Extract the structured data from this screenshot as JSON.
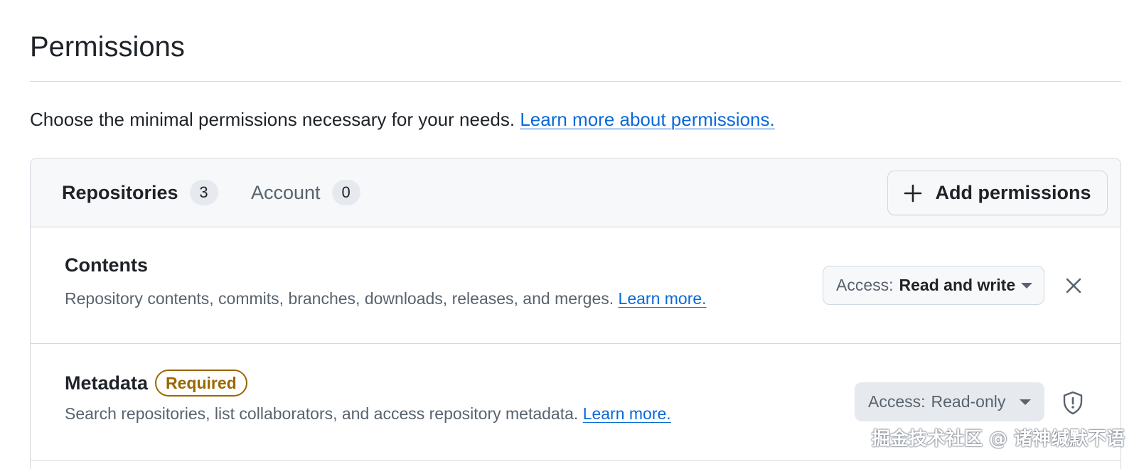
{
  "page": {
    "title": "Permissions",
    "intro_text": "Choose the minimal permissions necessary for your needs.",
    "intro_link": "Learn more about permissions."
  },
  "tabs": [
    {
      "label": "Repositories",
      "count": "3",
      "selected": true
    },
    {
      "label": "Account",
      "count": "0",
      "selected": false
    }
  ],
  "add_button": {
    "label": "Add permissions",
    "icon": "plus-icon"
  },
  "permissions": [
    {
      "name": "Contents",
      "badge": "",
      "description": "Repository contents, commits, branches, downloads, releases, and merges.",
      "learn_more": "Learn more.",
      "access_prefix": "Access:",
      "access_value": "Read and write",
      "trailing_icon": "close-icon"
    },
    {
      "name": "Metadata",
      "badge": "Required",
      "description": "Search repositories, list collaborators, and access repository metadata.",
      "learn_more": "Learn more.",
      "access_prefix": "Access:",
      "access_value": "Read-only",
      "trailing_icon": "shield-icon"
    }
  ],
  "watermark": "掘金技术社区 @ 诸神缄默不语",
  "colors": {
    "link": "#0969da",
    "required_badge": "#9a6700",
    "border": "#d1d9e0",
    "header_bg": "#f6f8fa"
  }
}
